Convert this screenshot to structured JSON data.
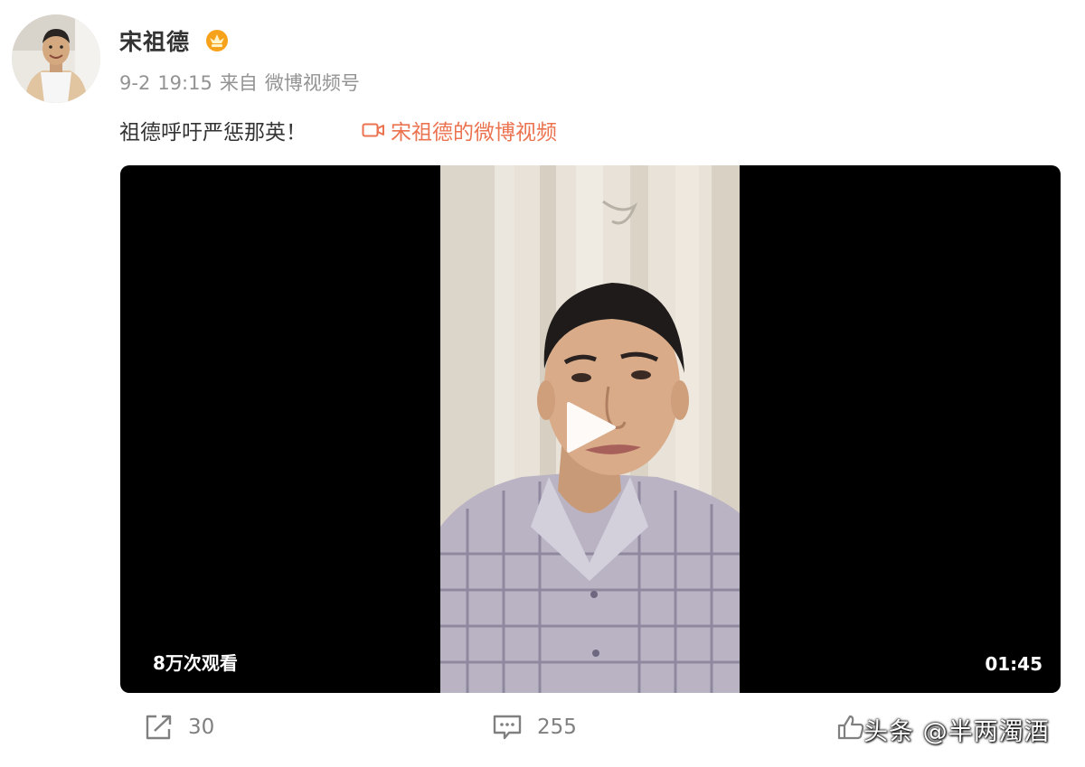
{
  "post": {
    "author": "宋祖德",
    "date": "9-2",
    "time": "19:15",
    "source_prefix": "来自",
    "source": "微博视频号",
    "text": "祖德呼吁严惩那英！",
    "video_link": "宋祖德的微博视频"
  },
  "video": {
    "views": "8万次观看",
    "duration": "01:45"
  },
  "actions": {
    "repost_count": "30",
    "comment_count": "255"
  },
  "watermark": "头条 @半两濁酒",
  "colors": {
    "accent": "#eb7350",
    "meta": "#939393",
    "text": "#333333",
    "icon": "#808080"
  },
  "icons": {
    "repost": "share-icon",
    "comment": "comment-icon",
    "like": "thumbs-up-icon",
    "badge": "vip-crown-icon",
    "video_link": "video-camera-icon",
    "play": "play-icon"
  }
}
